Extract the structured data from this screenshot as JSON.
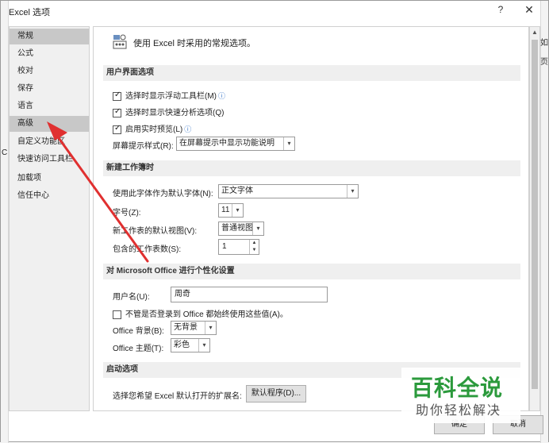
{
  "window": {
    "title": "Excel 选项",
    "help": "?",
    "close": "✕"
  },
  "nav": {
    "items": [
      "常规",
      "公式",
      "校对",
      "保存",
      "语言",
      "高级",
      "自定义功能区",
      "快速访问工具栏",
      "加载项",
      "信任中心"
    ]
  },
  "bg_right_labels": [
    "如",
    "页"
  ],
  "bg_left_label": "C",
  "intro": {
    "text": "使用 Excel 时采用的常规选项。"
  },
  "ui_options": {
    "header": "用户界面选项",
    "mini_toolbar": "选择时显示浮动工具栏(M)",
    "quick_analysis": "选择时显示快速分析选项(Q)",
    "live_preview": "启用实时预览(L)",
    "screentip_label": "屏幕提示样式(R):",
    "screentip_value": "在屏幕提示中显示功能说明"
  },
  "new_workbook": {
    "header": "新建工作簿时",
    "font_label": "使用此字体作为默认字体(N):",
    "font_value": "正文字体",
    "size_label": "字号(Z):",
    "size_value": "11",
    "view_label": "新工作表的默认视图(V):",
    "view_value": "普通视图",
    "sheets_label": "包含的工作表数(S):",
    "sheets_value": "1"
  },
  "personalize": {
    "header": "对 Microsoft Office 进行个性化设置",
    "username_label": "用户名(U):",
    "username_value": "周奇",
    "always_use": "不管是否登录到 Office 都始终使用这些值(A)。",
    "background_label": "Office 背景(B):",
    "background_value": "无背景",
    "theme_label": "Office 主题(T):",
    "theme_value": "彩色"
  },
  "startup": {
    "header": "启动选项",
    "ext_label": "选择您希望 Excel 默认打开的扩展名:",
    "default_programs": "默认程序(D)..."
  },
  "footer": {
    "ok": "确定",
    "cancel": "取消"
  },
  "watermark": {
    "main": "百科全说",
    "sub": "助你轻松解决"
  },
  "colors": {
    "arrow": "#e03030",
    "watermark_green": "#2b9a3c",
    "section_bg": "#efefef",
    "nav_selected": "#c8c8c8"
  }
}
